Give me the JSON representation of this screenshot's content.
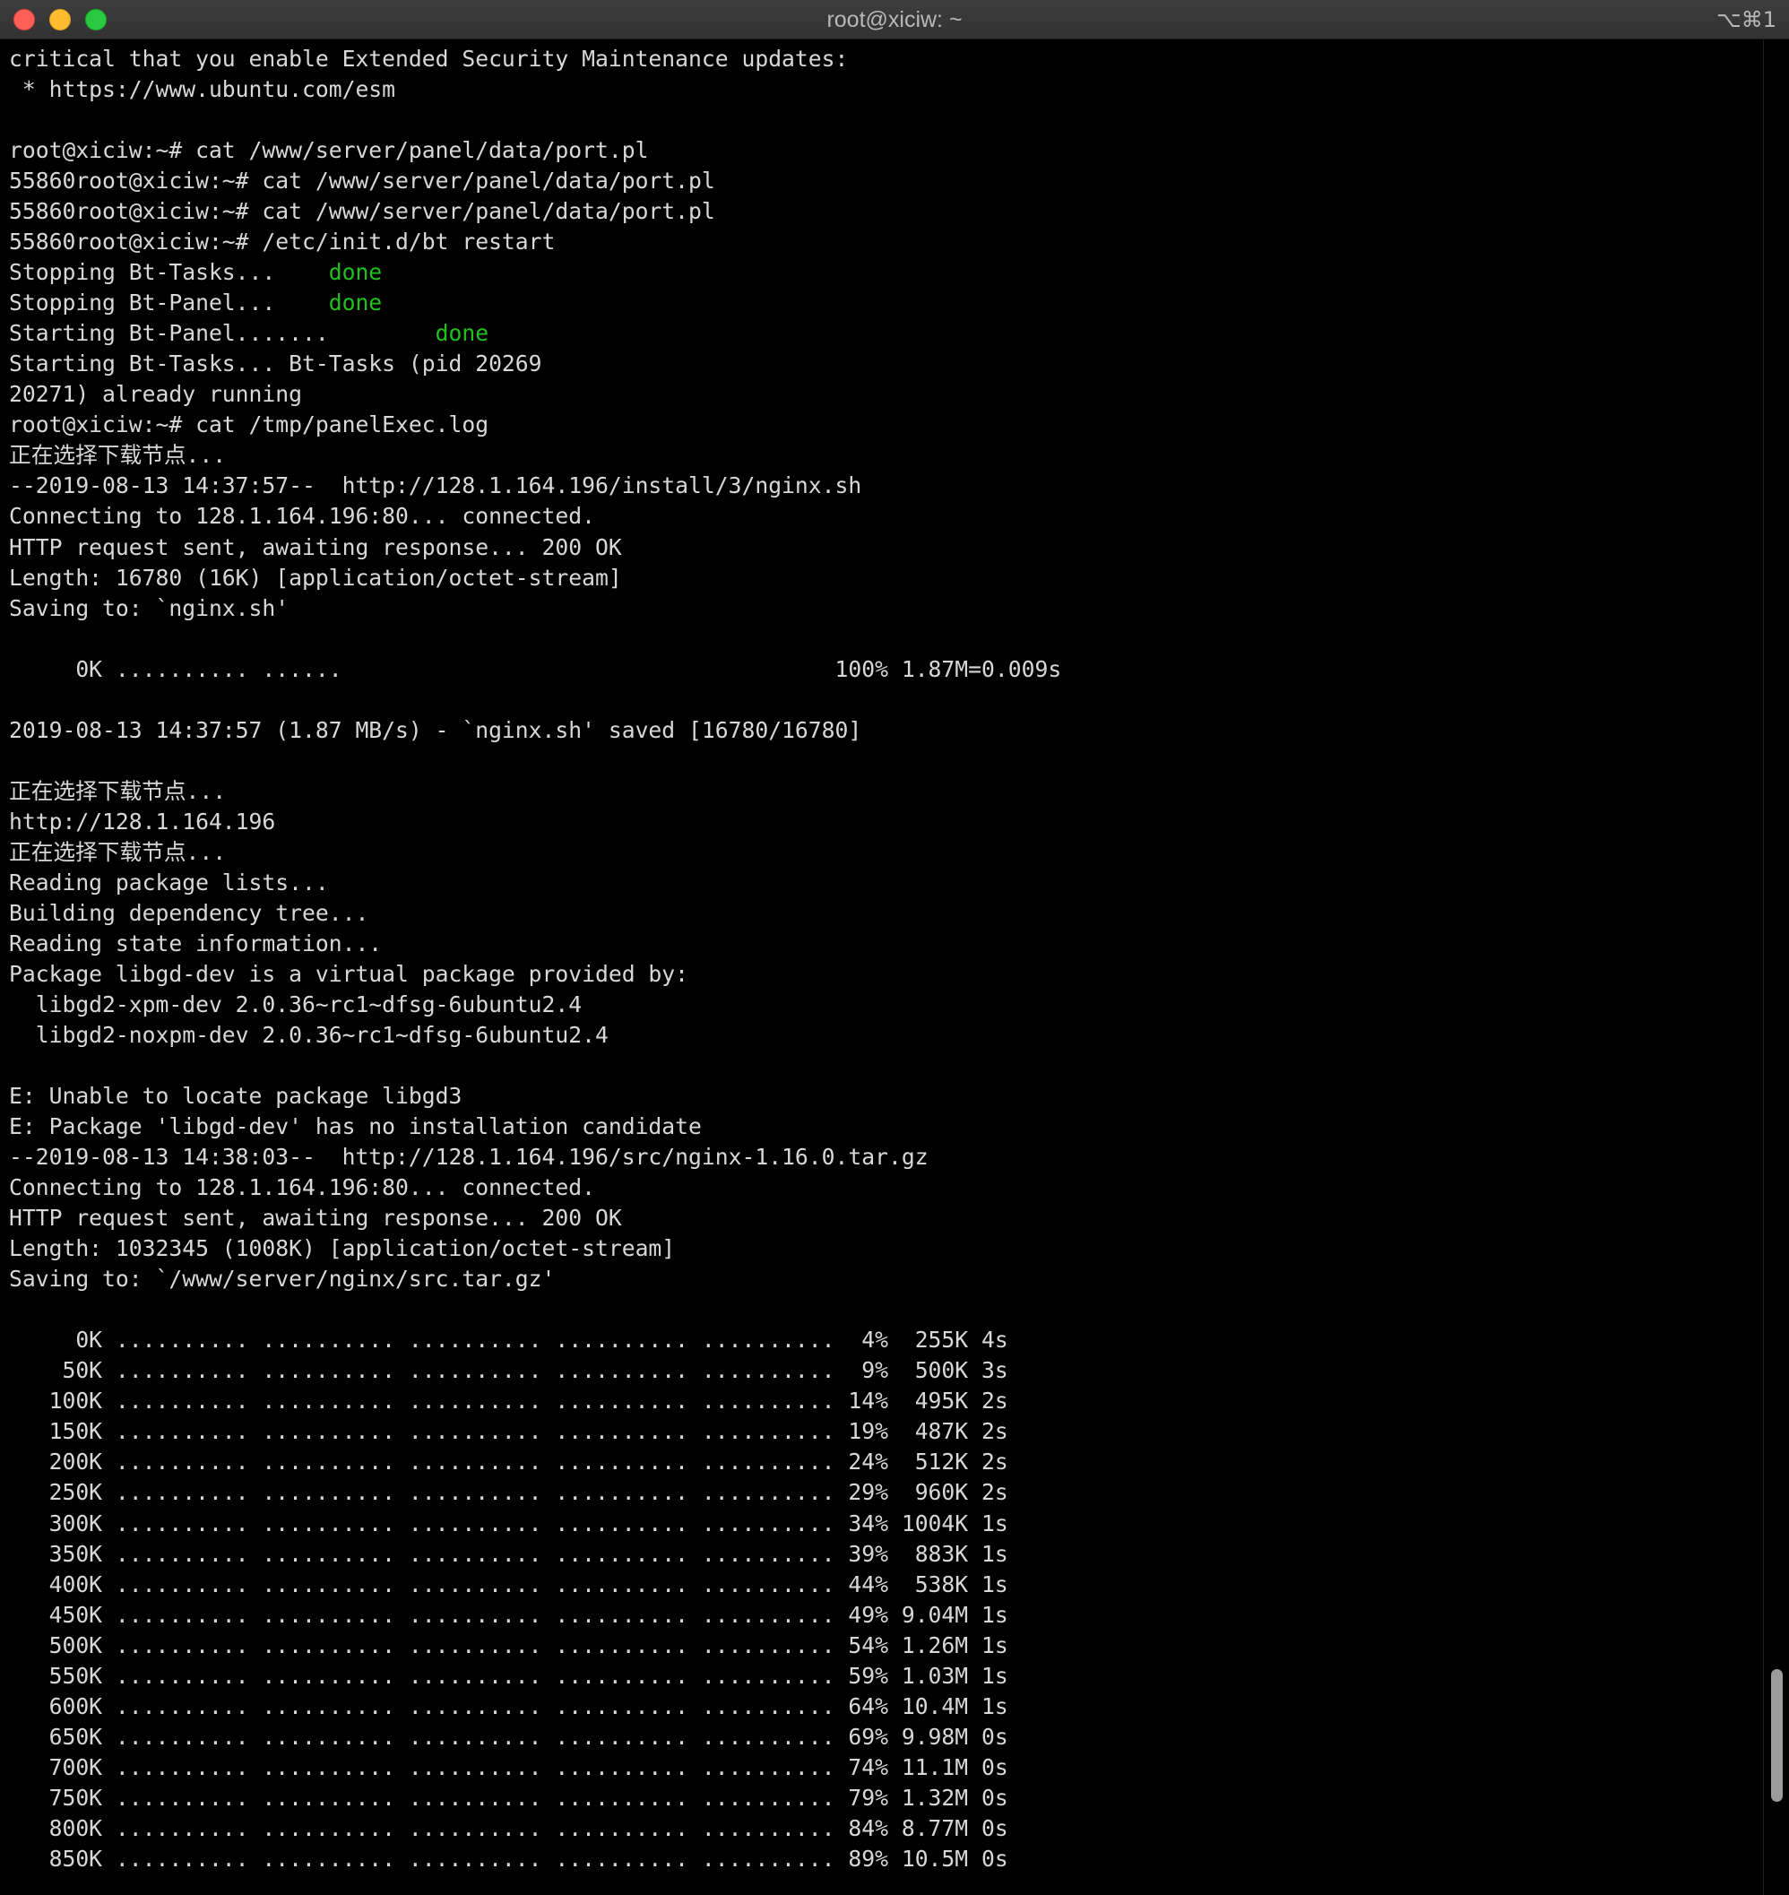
{
  "window": {
    "title": "root@xiciw: ~",
    "shortcut": "⌥⌘1"
  },
  "terminal": {
    "lines": [
      "critical that you enable Extended Security Maintenance updates:",
      " * https://www.ubuntu.com/esm",
      "",
      "root@xiciw:~# cat /www/server/panel/data/port.pl",
      "55860root@xiciw:~# cat /www/server/panel/data/port.pl",
      "55860root@xiciw:~# cat /www/server/panel/data/port.pl",
      "55860root@xiciw:~# /etc/init.d/bt restart",
      "Stopping Bt-Tasks...    done",
      "Stopping Bt-Panel...    done",
      "Starting Bt-Panel.......        done",
      "Starting Bt-Tasks... Bt-Tasks (pid 20269",
      "20271) already running",
      "root@xiciw:~# cat /tmp/panelExec.log",
      "正在选择下载节点...",
      "--2019-08-13 14:37:57--  http://128.1.164.196/install/3/nginx.sh",
      "Connecting to 128.1.164.196:80... connected.",
      "HTTP request sent, awaiting response... 200 OK",
      "Length: 16780 (16K) [application/octet-stream]",
      "Saving to: `nginx.sh'",
      "",
      "     0K .......... ......                                     100% 1.87M=0.009s",
      "",
      "2019-08-13 14:37:57 (1.87 MB/s) - `nginx.sh' saved [16780/16780]",
      "",
      "正在选择下载节点...",
      "http://128.1.164.196",
      "正在选择下载节点...",
      "Reading package lists...",
      "Building dependency tree...",
      "Reading state information...",
      "Package libgd-dev is a virtual package provided by:",
      "  libgd2-xpm-dev 2.0.36~rc1~dfsg-6ubuntu2.4",
      "  libgd2-noxpm-dev 2.0.36~rc1~dfsg-6ubuntu2.4",
      "",
      "E: Unable to locate package libgd3",
      "E: Package 'libgd-dev' has no installation candidate",
      "--2019-08-13 14:38:03--  http://128.1.164.196/src/nginx-1.16.0.tar.gz",
      "Connecting to 128.1.164.196:80... connected.",
      "HTTP request sent, awaiting response... 200 OK",
      "Length: 1032345 (1008K) [application/octet-stream]",
      "Saving to: `/www/server/nginx/src.tar.gz'",
      "",
      "     0K .......... .......... .......... .......... ..........  4%  255K 4s",
      "    50K .......... .......... .......... .......... ..........  9%  500K 3s",
      "   100K .......... .......... .......... .......... .......... 14%  495K 2s",
      "   150K .......... .......... .......... .......... .......... 19%  487K 2s",
      "   200K .......... .......... .......... .......... .......... 24%  512K 2s",
      "   250K .......... .......... .......... .......... .......... 29%  960K 2s",
      "   300K .......... .......... .......... .......... .......... 34% 1004K 1s",
      "   350K .......... .......... .......... .......... .......... 39%  883K 1s",
      "   400K .......... .......... .......... .......... .......... 44%  538K 1s",
      "   450K .......... .......... .......... .......... .......... 49% 9.04M 1s",
      "   500K .......... .......... .......... .......... .......... 54% 1.26M 1s",
      "   550K .......... .......... .......... .......... .......... 59% 1.03M 1s",
      "   600K .......... .......... .......... .......... .......... 64% 10.4M 1s",
      "   650K .......... .......... .......... .......... .......... 69% 9.98M 0s",
      "   700K .......... .......... .......... .......... .......... 74% 11.1M 0s",
      "   750K .......... .......... .......... .......... .......... 79% 1.32M 0s",
      "   800K .......... .......... .......... .......... .......... 84% 8.77M 0s",
      "   850K .......... .......... .......... .......... .......... 89% 10.5M 0s"
    ],
    "highlight_word": "done",
    "highlight_color": "#21c11c",
    "text_color": "#d8d8d8",
    "background": "#000000"
  }
}
